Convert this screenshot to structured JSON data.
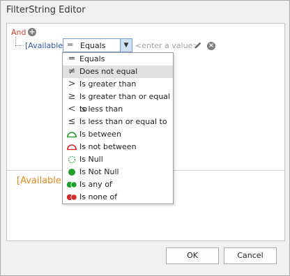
{
  "window": {
    "title": "FilterString Editor"
  },
  "filter": {
    "group_operator": "And",
    "field": "[Available]",
    "operator": {
      "label": "Equals",
      "symbol": "═"
    },
    "value_placeholder": "<enter a value>"
  },
  "preview": {
    "text": "[Available]"
  },
  "operators": [
    {
      "label": "Equals",
      "icon": "equals-icon",
      "glyph": "═"
    },
    {
      "label": "Does not equal",
      "icon": "not-equal-icon",
      "glyph": "≠",
      "hovered": true
    },
    {
      "label": "Is greater than",
      "icon": "greater-than-icon",
      "glyph": ">"
    },
    {
      "label": "Is greater than or equal to",
      "icon": "greater-equal-icon",
      "glyph": "≥"
    },
    {
      "label": "Is less than",
      "icon": "less-than-icon",
      "glyph": "<"
    },
    {
      "label": "Is less than or equal to",
      "icon": "less-equal-icon",
      "glyph": "≤"
    },
    {
      "label": "Is between",
      "icon": "between-icon"
    },
    {
      "label": "Is not between",
      "icon": "not-between-icon"
    },
    {
      "label": "Is Null",
      "icon": "null-icon"
    },
    {
      "label": "Is Not Null",
      "icon": "not-null-icon"
    },
    {
      "label": "Is any of",
      "icon": "any-of-icon"
    },
    {
      "label": "Is none of",
      "icon": "none-of-icon"
    }
  ],
  "buttons": {
    "ok": "OK",
    "cancel": "Cancel"
  },
  "colors": {
    "group_operator": "#d33a2c",
    "field": "#2a55b0",
    "preview": "#e08a1e",
    "green_icon": "#1fa12c",
    "red_icon": "#d32a2a"
  }
}
